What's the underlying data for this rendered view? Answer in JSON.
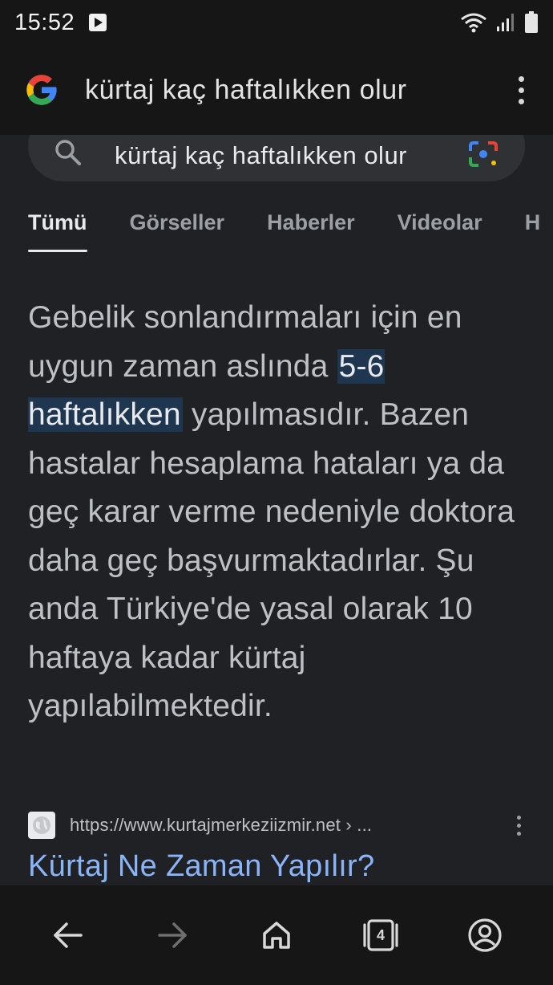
{
  "status_bar": {
    "time": "15:52"
  },
  "url_bar": {
    "query": "kürtaj kaç haftalıkken olur"
  },
  "search": {
    "query": "kürtaj kaç haftalıkken olur"
  },
  "tabs": [
    {
      "label": "Tümü",
      "active": true
    },
    {
      "label": "Görseller",
      "active": false
    },
    {
      "label": "Haberler",
      "active": false
    },
    {
      "label": "Videolar",
      "active": false
    },
    {
      "label": "H",
      "active": false
    }
  ],
  "answer": {
    "before": "Gebelik sonlandırmaları için en uygun zaman aslında ",
    "highlight": "5-6 haftalıkken",
    "after": " yapılmasıdır. Bazen hastalar hesaplama hataları ya da geç karar verme nedeniyle doktora daha geç başvurmaktadırlar. Şu anda Türkiye'de yasal olarak 10 haftaya kadar kürtaj yapılabilmektedir."
  },
  "result": {
    "url": "https://www.kurtajmerkeziizmir.net › ...",
    "title": "Kürtaj Ne Zaman Yapılır?"
  },
  "bottom_nav": {
    "tab_count": "4"
  },
  "colors": {
    "background": "#202124",
    "bars": "#161616",
    "link": "#8ab4f8",
    "highlight": "#1f3650"
  }
}
